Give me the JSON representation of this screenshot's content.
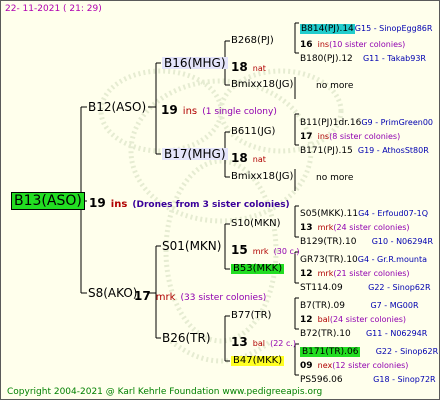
{
  "date_label": "22- 11-2021 ( 21: 29)",
  "copyright": "Copyright 2004-2021 @ Karl Kehrle Foundation    www.pedigreeapis.org",
  "root": {
    "id": "B13(ASO)",
    "num": "19",
    "ins": "ins",
    "note": "(Drones from 3 sister colonies)"
  },
  "g1": [
    {
      "id": "B12(ASO)",
      "num": "19",
      "ins": "ins",
      "note": "(1 single colony)"
    },
    {
      "id": "S8(AKO)",
      "num": "17",
      "ins": "mrk",
      "note": "(33 sister colonies)"
    }
  ],
  "g2": [
    {
      "id": "B16(MHG)",
      "num": "18",
      "ins": "nat"
    },
    {
      "id": "B17(MHG)",
      "num": "18",
      "ins": "nat"
    },
    {
      "id": "S01(MKN)",
      "num": "15",
      "ins": "mrk",
      "note": "(30 c.)"
    },
    {
      "id": "B26(TR)",
      "num": "13",
      "ins": "bal",
      "note": "(22 c.)"
    }
  ],
  "g3": [
    {
      "id": "B268(PJ)",
      "num": "18",
      "ins": "nat"
    },
    {
      "id": "Bmixx18(JG)"
    },
    {
      "id": "B611(JG)",
      "num": "18",
      "ins": "nat"
    },
    {
      "id": "Bmixx18(JG)"
    },
    {
      "id": "S10(MKN)",
      "num": "13",
      "ins": "mrk",
      "note": "(24 c.)"
    },
    {
      "id": "B53(MKK)"
    },
    {
      "id": "B77(TR)",
      "num": "13",
      "ins": "bal",
      "note": "(22 c.)"
    },
    {
      "id": "B47(MKK)"
    }
  ],
  "g4": [
    {
      "mother": "B814(PJ).14",
      "breeder": "G15 - SinopEgg86R",
      "num": "16",
      "ins": "ins",
      "note": "(10 sister colonies)",
      "father": "B180(PJ).12",
      "fbreeder": "G11 - Takab93R"
    },
    {
      "nomore": "no more"
    },
    {
      "mother": "B11(PJ)1dr.16",
      "breeder": "G9 - PrimGreen00",
      "num": "17",
      "ins": "ins",
      "note": "(8 sister colonies)",
      "father": "B171(PJ).15",
      "fbreeder": "G19 - AthosSt80R"
    },
    {
      "nomore": "no more"
    },
    {
      "mother": "S05(MKK).11",
      "breeder": "G4 - Erfoud07-1Q",
      "num": "13",
      "ins": "mrk",
      "note": "(24 sister colonies)",
      "father": "B129(TR).10",
      "fbreeder": "G10 - N06294R"
    },
    {
      "mother": "GR73(TR).10",
      "breeder": "G4 - Gr.R.mounta",
      "num": "12",
      "ins": "mrk",
      "note": "(21 sister colonies)",
      "father": "ST114.09",
      "fbreeder": "G22 - Sinop62R"
    },
    {
      "mother": "B7(TR).09",
      "breeder": "G7 - MG00R",
      "num": "12",
      "ins": "bal",
      "note": "(24 sister colonies)",
      "father": "B72(TR).10",
      "fbreeder": "G11 - N06294R"
    },
    {
      "mother": "B171(TR).06",
      "breeder": "G22 - Sinop62R",
      "num": "09",
      "ins": "nex",
      "note": "(12 sister colonies)",
      "father": "PS596.06",
      "fbreeder": "G18 - Sinop72R"
    }
  ]
}
